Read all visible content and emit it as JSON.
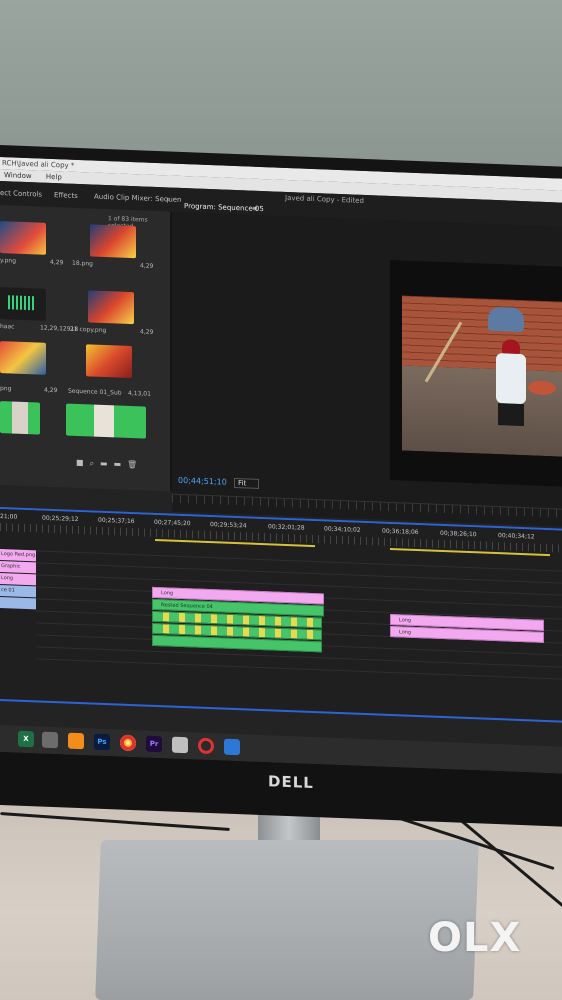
{
  "window": {
    "title": "RCH\\Javed ali Copy *",
    "menu": [
      "Window",
      "Help"
    ]
  },
  "panels": {
    "tabs": [
      "ect Controls",
      "Effects",
      "Audio Clip Mixer: Sequen"
    ],
    "tab_more": "»",
    "project_title": "Javed ali Copy - Edited",
    "program_tab": "Program: Sequence 05",
    "menu_icon": "≡"
  },
  "project": {
    "items_selected": "1 of 83 items selected",
    "items": [
      {
        "name": "y.png",
        "duration": "4,29"
      },
      {
        "name": "18.png",
        "duration": "4,29"
      },
      {
        "name": "haac",
        "duration": "12,29,12918"
      },
      {
        "name": "21 copy.png",
        "duration": "4,29"
      },
      {
        "name": "png",
        "duration": "4,29"
      },
      {
        "name": "Sequence 01_Sub",
        "duration": "4,13,01"
      }
    ],
    "tool_icons": [
      "■",
      "⌕",
      "▬",
      "▬",
      "🗑"
    ]
  },
  "program": {
    "timecode": "00;44;51;10",
    "zoom": "Fit",
    "transport": [
      "◆",
      "{",
      "}",
      "|◀",
      "◀|",
      "▶",
      "|▶",
      "▶|"
    ]
  },
  "timeline": {
    "ticks": [
      "21;00",
      "00;25;29;12",
      "00;25;37;16",
      "00;27;45;20",
      "00;29;53;24",
      "00;32;01;28",
      "00;34;10;02",
      "00;36;18;06",
      "00;38;26;10",
      "00;40;34;12"
    ],
    "track_labels": [
      "Logo Red.png",
      "Graphic",
      "Long",
      "ce 01",
      "",
      ""
    ],
    "clips": {
      "pink_1": "Long",
      "green_1": "Nested Sequence 04",
      "pink_2": "Long",
      "pink_3": "Long"
    }
  },
  "taskbar": {
    "apps": [
      "X",
      "Ps",
      "Pr"
    ]
  },
  "monitor_brand": "DELL",
  "watermark": "OLX"
}
